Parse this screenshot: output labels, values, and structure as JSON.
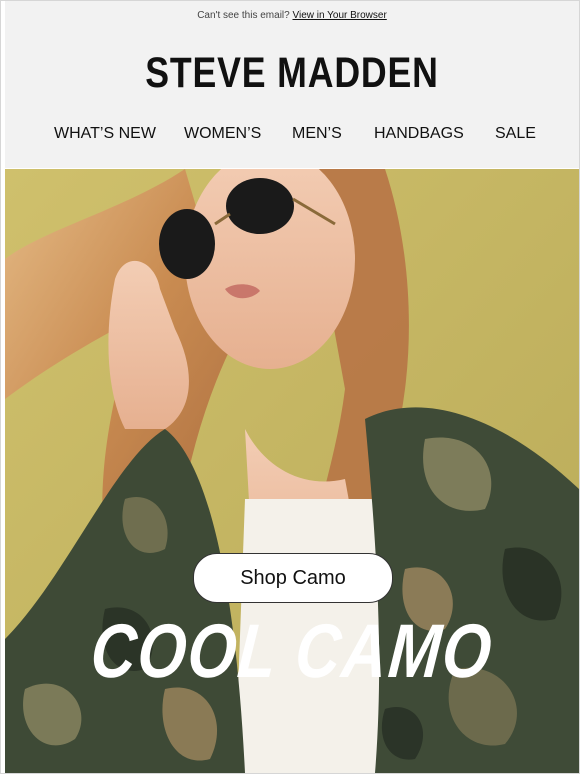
{
  "preheader": {
    "text": "Can't see this email?",
    "link": "View in Your Browser"
  },
  "brand": {
    "logo_text": "STEVE MADDEN"
  },
  "nav": {
    "items": [
      "WHAT’S NEW",
      "WOMEN’S",
      "MEN’S",
      "HANDBAGS",
      "SALE"
    ]
  },
  "hero": {
    "headline": "COOL CAMO",
    "cta_label": "Shop Camo",
    "image": "woman-in-sunglasses-and-camo-jacket"
  },
  "colors": {
    "header_bg": "#f2f2f2",
    "hero_bg": "#c5b663",
    "text": "#111111",
    "cta_bg": "#ffffff"
  }
}
